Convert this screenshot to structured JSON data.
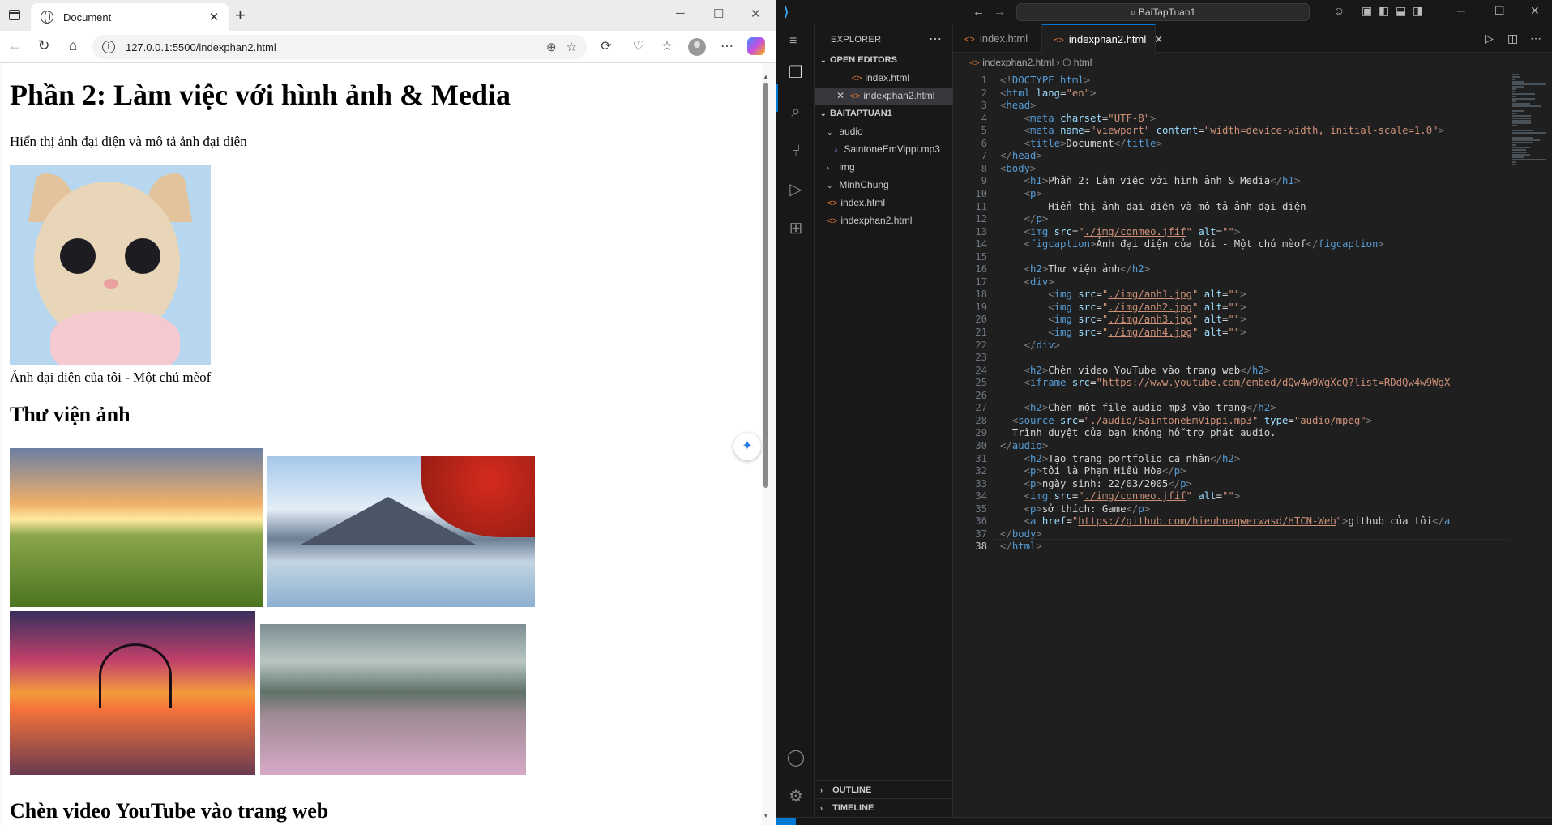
{
  "browser": {
    "tab_title": "Document",
    "url": "127.0.0.1:5500/indexphan2.html",
    "page": {
      "h1": "Phần 2: Làm việc với hình ảnh & Media",
      "intro": "Hiển thị ảnh đại diện và mô tả ảnh đại diện",
      "caption": "Ảnh đại diện của tôi - Một chú mèof",
      "gallery_heading": "Thư viện ảnh",
      "video_heading": "Chèn video YouTube vào trang web"
    }
  },
  "vscode": {
    "search": "BaiTapTuan1",
    "explorer_title": "EXPLORER",
    "open_editors_label": "OPEN EDITORS",
    "open_editors": [
      "index.html",
      "indexphan2.html"
    ],
    "project_label": "BAITAPTUAN1",
    "tree": [
      {
        "label": "audio",
        "kind": "folder-open",
        "depth": 1
      },
      {
        "label": "SaintoneEmVippi.mp3",
        "kind": "mp3",
        "depth": 2
      },
      {
        "label": "img",
        "kind": "folder",
        "depth": 1
      },
      {
        "label": "MinhChung",
        "kind": "folder-open",
        "depth": 1
      },
      {
        "label": "index.html",
        "kind": "html",
        "depth": 1
      },
      {
        "label": "indexphan2.html",
        "kind": "html",
        "depth": 1
      }
    ],
    "tabs": [
      "index.html",
      "indexphan2.html"
    ],
    "breadcrumb": [
      "indexphan2.html",
      "html"
    ],
    "outline_label": "OUTLINE",
    "timeline_label": "TIMELINE",
    "current_line": "38",
    "code_lines": [
      "<!DOCTYPE html>",
      "<html lang=\"en\">",
      "<head>",
      "    <meta charset=\"UTF-8\">",
      "    <meta name=\"viewport\" content=\"width=device-width, initial-scale=1.0\">",
      "    <title>Document</title>",
      "</head>",
      "<body>",
      "    <h1>Phần 2: Làm việc với hình ảnh & Media</h1>",
      "    <p>",
      "        Hiển thị ảnh đại diện và mô tả ảnh đại diện",
      "    </p>",
      "    <img src=\"./img/conmeo.jfif\" alt=\"\">",
      "    <figcaption>Ảnh đại diện của tôi - Một chú mèof</figcaption>",
      "",
      "    <h2>Thư viện ảnh</h2>",
      "    <div>",
      "        <img src=\"./img/anh1.jpg\" alt=\"\">",
      "        <img src=\"./img/anh2.jpg\" alt=\"\">",
      "        <img src=\"./img/anh3.jpg\" alt=\"\">",
      "        <img src=\"./img/anh4.jpg\" alt=\"\">",
      "    </div>",
      "",
      "    <h2>Chèn video YouTube vào trang web</h2>",
      "    <iframe src=\"https://www.youtube.com/embed/dQw4w9WgXcQ?list=RDdQw4w9WgX",
      "",
      "    <h2>Chèn một file audio mp3 vào trang</h2>",
      "  <source src=\"./audio/SaintoneEmVippi.mp3\" type=\"audio/mpeg\">",
      "  Trình duyệt của bạn không hỗ trợ phát audio.",
      "</audio>",
      "    <h2>Tạo trang portfolio cá nhân</h2>",
      "    <p>tôi là Phạm Hiếu Hòa</p>",
      "    <p>ngày sinh: 22/03/2005</p>",
      "    <img src=\"./img/conmeo.jfif\" alt=\"\">",
      "    <p>sở thích: Game</p>",
      "    <a href=\"https://github.com/hieuhoaqwerwasd/HTCN-Web\">github của tôi</a",
      "</body>",
      "</html>"
    ]
  }
}
